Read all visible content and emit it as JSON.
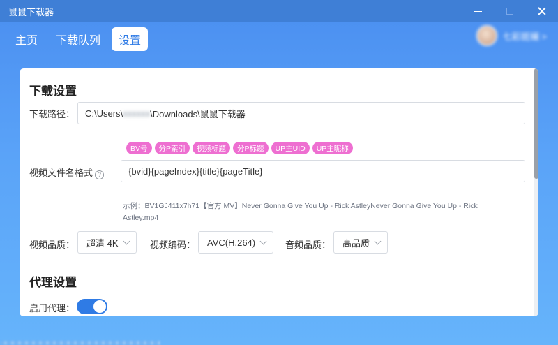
{
  "app": {
    "title": "鼠鼠下载器",
    "username": "七彩斑斓 >"
  },
  "nav": {
    "tabs": [
      "主页",
      "下载队列",
      "设置"
    ],
    "active": "设置"
  },
  "download_settings": {
    "title": "下载设置",
    "path_label": "下载路径：",
    "path_prefix": "C:\\Users\\",
    "path_user": "xxxxxx",
    "path_suffix": "\\Downloads\\鼠鼠下载器",
    "tags": [
      "BV号",
      "分P索引",
      "视频标题",
      "分P标题",
      "UP主UID",
      "UP主昵称"
    ],
    "filename_label": "视频文件名格式",
    "help_glyph": "?",
    "filename_format": "{bvid}{pageIndex}{title}{pageTitle}",
    "example": "示例：BV1GJ411x7h71【官方 MV】Never Gonna Give You Up - Rick AstleyNever Gonna Give You Up - Rick Astley.mp4",
    "quality_label": "视频品质：",
    "quality_value": "超清 4K",
    "codec_label": "视频编码：",
    "codec_value": "AVC(H.264)",
    "audio_label": "音频品质：",
    "audio_value": "高品质"
  },
  "proxy_settings": {
    "title": "代理设置",
    "enable_label": "启用代理：",
    "enabled": true
  },
  "colors": {
    "accent": "#2f7be5",
    "tag": "#ee6fd1",
    "titlebar": "#3f7fd6"
  }
}
